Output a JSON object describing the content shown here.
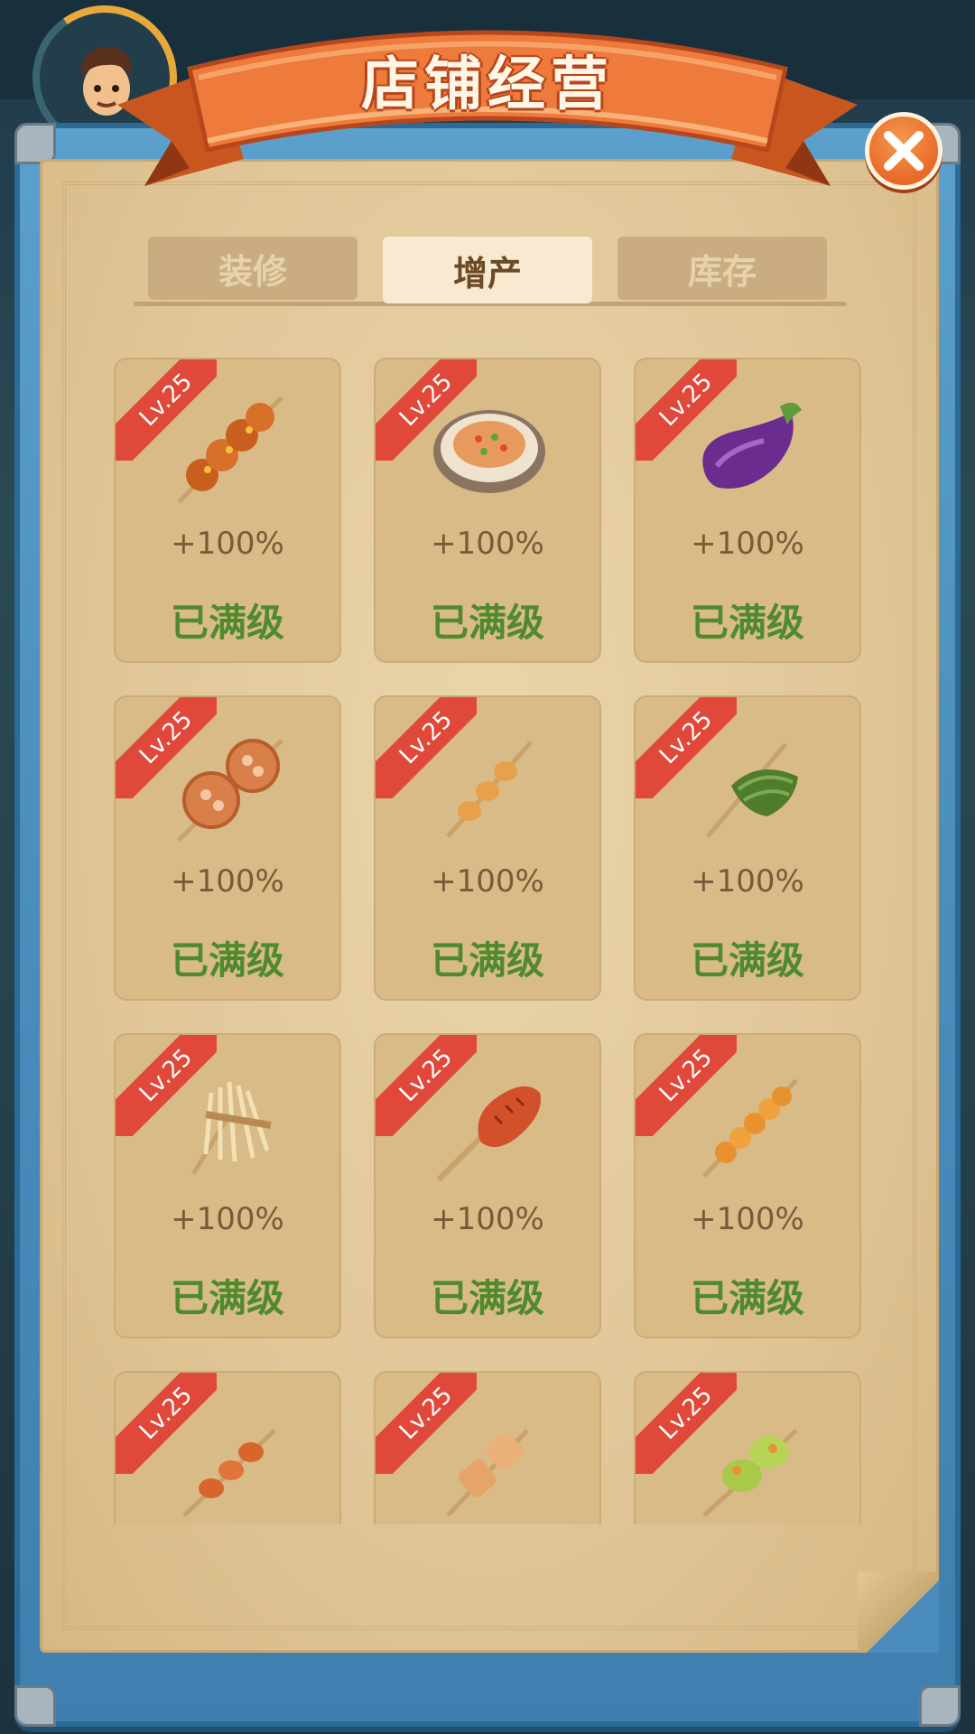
{
  "title": "店铺经营",
  "tabs": [
    {
      "label": "装修",
      "active": false
    },
    {
      "label": "增产",
      "active": true
    },
    {
      "label": "库存",
      "active": false
    }
  ],
  "items": [
    {
      "level": "Lv.25",
      "bonus": "+100%",
      "status": "已满级",
      "icon": "meat-skewer-icon"
    },
    {
      "level": "Lv.25",
      "bonus": "+100%",
      "status": "已满级",
      "icon": "oyster-icon"
    },
    {
      "level": "Lv.25",
      "bonus": "+100%",
      "status": "已满级",
      "icon": "eggplant-icon"
    },
    {
      "level": "Lv.25",
      "bonus": "+100%",
      "status": "已满级",
      "icon": "lotus-root-skewer-icon"
    },
    {
      "level": "Lv.25",
      "bonus": "+100%",
      "status": "已满级",
      "icon": "quail-egg-skewer-icon"
    },
    {
      "level": "Lv.25",
      "bonus": "+100%",
      "status": "已满级",
      "icon": "chive-skewer-icon"
    },
    {
      "level": "Lv.25",
      "bonus": "+100%",
      "status": "已满级",
      "icon": "enoki-mushroom-icon"
    },
    {
      "level": "Lv.25",
      "bonus": "+100%",
      "status": "已满级",
      "icon": "sausage-skewer-icon"
    },
    {
      "level": "Lv.25",
      "bonus": "+100%",
      "status": "已满级",
      "icon": "fishball-skewer-icon"
    },
    {
      "level": "Lv.25",
      "bonus": "",
      "status": "",
      "icon": "shrimp-skewer-icon"
    },
    {
      "level": "Lv.25",
      "bonus": "",
      "status": "",
      "icon": "tofu-skewer-icon"
    },
    {
      "level": "Lv.25",
      "bonus": "",
      "status": "",
      "icon": "pepper-skewer-icon"
    }
  ],
  "colors": {
    "ribbon": "#ee7a3c",
    "frame": "#4a8dbd",
    "paper": "#e0c697",
    "card": "#d9bb87",
    "level_tag": "#e0483a",
    "maxed_text": "#4f8a2f"
  }
}
